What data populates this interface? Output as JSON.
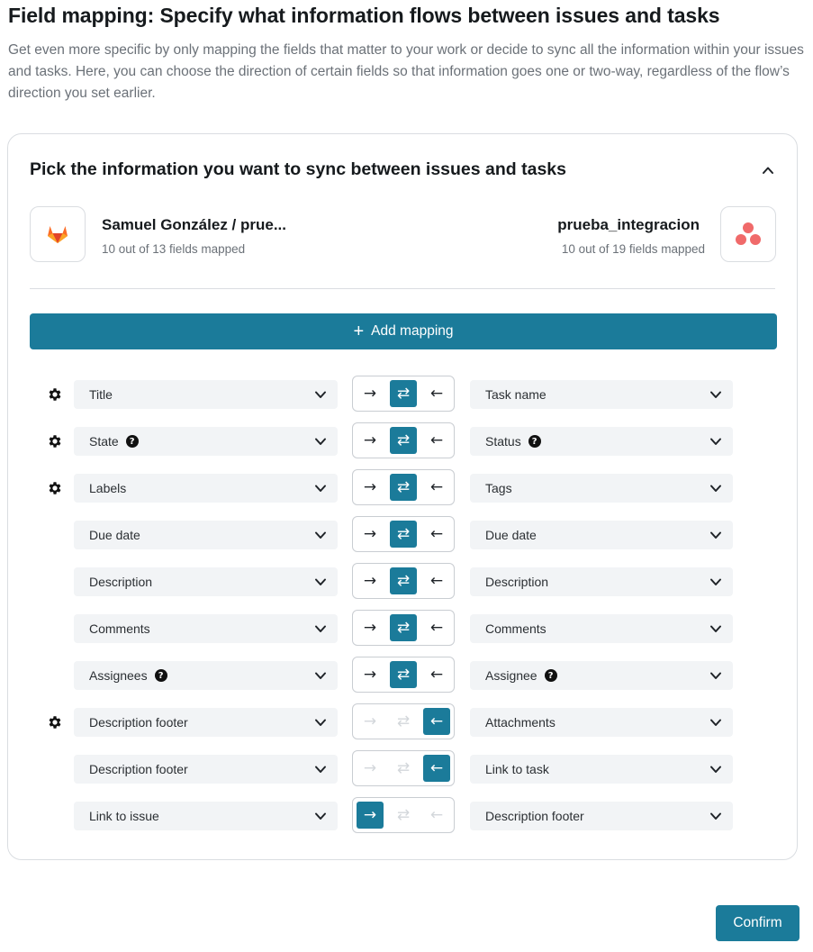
{
  "page": {
    "title": "Field mapping: Specify what information flows between issues and tasks",
    "description": "Get even more specific by only mapping the fields that matter to your work or decide to sync all the information within your issues and tasks. Here, you can choose the direction of certain fields so that information goes one or two-way, regardless of the flow’s direction you set earlier."
  },
  "card": {
    "title": "Pick the information you want to sync between issues and tasks",
    "collapse_icon": "chevron-up-icon"
  },
  "systems": {
    "left": {
      "name": "Samuel González / prue...",
      "fields_mapped": "10 out of 13 fields mapped",
      "logo": "gitlab-logo"
    },
    "right": {
      "name": "prueba_integracion",
      "fields_mapped": "10 out of 19 fields mapped",
      "logo": "asana-logo"
    }
  },
  "add_mapping": {
    "label": "Add mapping",
    "icon": "plus-icon"
  },
  "direction_glyphs": {
    "to_right": "→",
    "both": "⇄",
    "to_left": "←"
  },
  "colors": {
    "accent": "#1b7b9a",
    "field_bg": "#f2f4f6",
    "muted_arrow": "#d3d7db"
  },
  "mappings": [
    {
      "left": "Title",
      "left_help": false,
      "right": "Task name",
      "right_help": false,
      "direction": "both",
      "settings": true
    },
    {
      "left": "State",
      "left_help": true,
      "right": "Status",
      "right_help": true,
      "direction": "both",
      "settings": true
    },
    {
      "left": "Labels",
      "left_help": false,
      "right": "Tags",
      "right_help": false,
      "direction": "both",
      "settings": true
    },
    {
      "left": "Due date",
      "left_help": false,
      "right": "Due date",
      "right_help": false,
      "direction": "both",
      "settings": false
    },
    {
      "left": "Description",
      "left_help": false,
      "right": "Description",
      "right_help": false,
      "direction": "both",
      "settings": false
    },
    {
      "left": "Comments",
      "left_help": false,
      "right": "Comments",
      "right_help": false,
      "direction": "both",
      "settings": false
    },
    {
      "left": "Assignees",
      "left_help": true,
      "right": "Assignee",
      "right_help": true,
      "direction": "both",
      "settings": false
    },
    {
      "left": "Description footer",
      "left_help": false,
      "right": "Attachments",
      "right_help": false,
      "direction": "to_left",
      "settings": true
    },
    {
      "left": "Description footer",
      "left_help": false,
      "right": "Link to task",
      "right_help": false,
      "direction": "to_left",
      "settings": false
    },
    {
      "left": "Link to issue",
      "left_help": false,
      "right": "Description footer",
      "right_help": false,
      "direction": "to_right",
      "settings": false
    }
  ],
  "confirm": {
    "label": "Confirm"
  }
}
